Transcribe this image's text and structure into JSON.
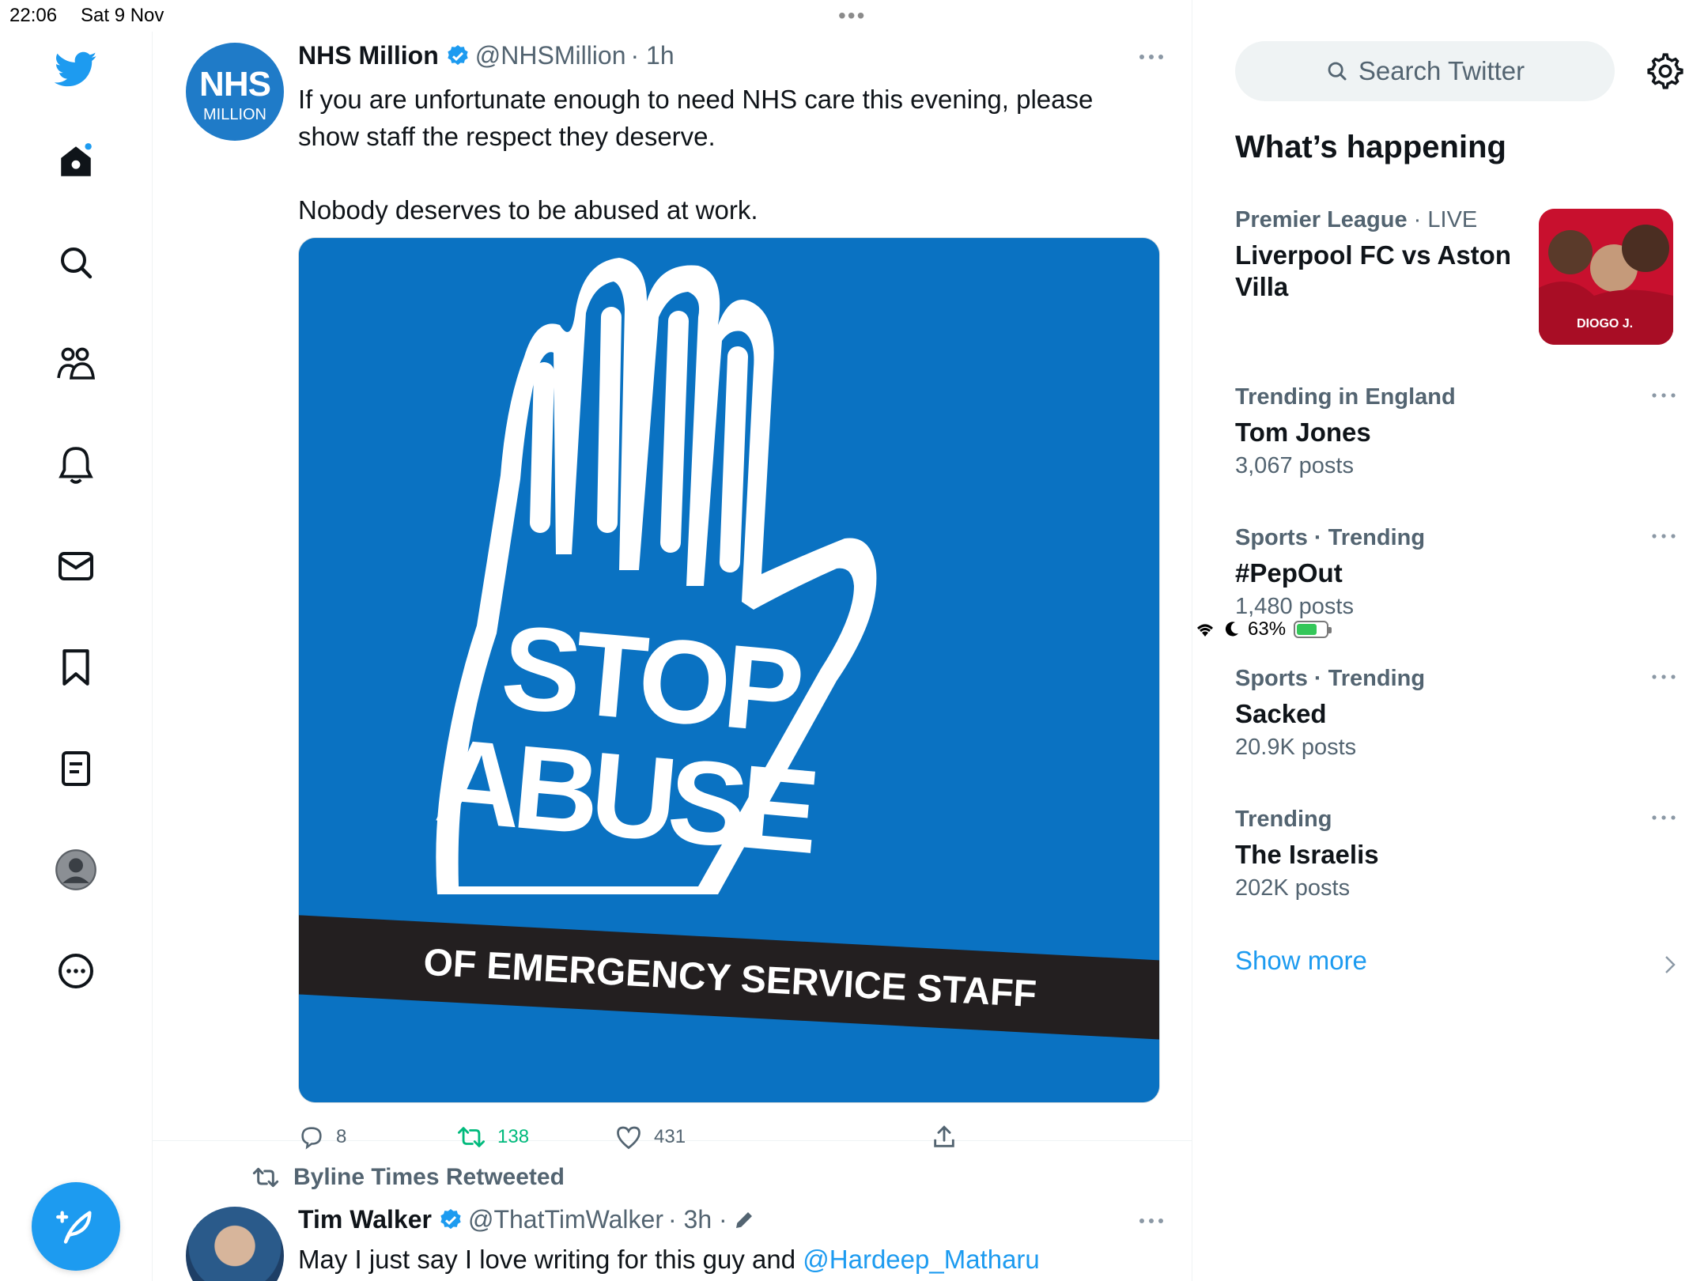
{
  "status_bar": {
    "time": "22:06",
    "date": "Sat 9 Nov",
    "battery": "63%",
    "battery_level": 0.63
  },
  "nav": {
    "items": [
      "twitter-logo",
      "home",
      "explore",
      "communities",
      "notifications",
      "messages",
      "bookmarks",
      "lists",
      "profile",
      "more"
    ],
    "accent_color": "#1d9bf0"
  },
  "tweet1": {
    "author_name": "NHS Million",
    "author_handle": "@NHSMillion",
    "time": "· 1h",
    "avatar_line1": "NHS",
    "avatar_line2": "MILLION",
    "text_p1": "If you are unfortunate enough to need NHS care this evening, please show staff the respect they deserve.",
    "text_p2": "Nobody deserves to be abused at work.",
    "image": {
      "line1": "STOP",
      "line2": "ABUSE",
      "banner": "OF EMERGENCY SERVICE STAFF",
      "bg_color": "#0a72c2"
    },
    "replies": "8",
    "retweets": "138",
    "likes": "431"
  },
  "tweet2": {
    "retweeted_by": "Byline Times Retweeted",
    "author_name": "Tim Walker",
    "author_handle": "@ThatTimWalker",
    "time": "· 3h ·",
    "text": "May I just say I love writing for this guy and ",
    "mention": "@Hardeep_Matharu"
  },
  "sidebar": {
    "search_placeholder": "Search Twitter",
    "section_title": "What’s happening",
    "featured": {
      "category": "Premier League",
      "status": "· LIVE",
      "title": "Liverpool FC vs Aston Villa",
      "thumb_text": "DIOGO J."
    },
    "trends": [
      {
        "meta": "Trending in England",
        "title": "Tom Jones",
        "count": "3,067 posts"
      },
      {
        "meta": "Sports · Trending",
        "title": "#PepOut",
        "count": "1,480 posts"
      },
      {
        "meta": "Sports · Trending",
        "title": "Sacked",
        "count": "20.9K posts"
      },
      {
        "meta": "Trending",
        "title": "The Israelis",
        "count": "202K posts"
      }
    ],
    "show_more": "Show more"
  }
}
